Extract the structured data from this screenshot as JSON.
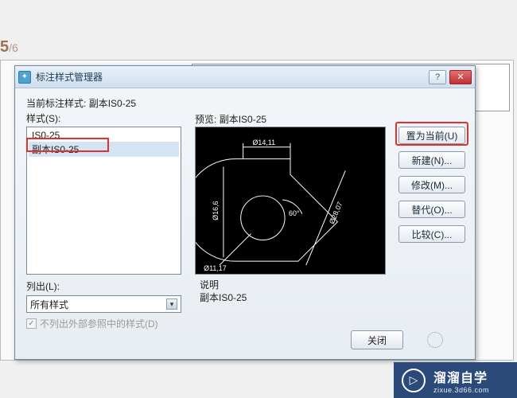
{
  "page": {
    "current": "5",
    "total": "/6"
  },
  "dialog": {
    "title": "标注样式管理器",
    "current_style_label": "当前标注样式:",
    "current_style_value": "副本IS0-25",
    "styles_label": "样式(S):",
    "styles": [
      {
        "name": "IS0-25"
      },
      {
        "name": "副本IS0-25"
      }
    ],
    "list_label": "列出(L):",
    "list_value": "所有样式",
    "checkbox_label": "不列出外部参照中的样式(D)",
    "preview_label_prefix": "预览:",
    "preview_label_value": "副本IS0-25",
    "desc_label": "说明",
    "desc_value": "副本IS0-25",
    "buttons": {
      "set_current": "置为当前(U)",
      "new": "新建(N)...",
      "modify": "修改(M)...",
      "override": "替代(O)...",
      "compare": "比较(C)..."
    },
    "close": "关闭",
    "help": "?",
    "x": "✕"
  },
  "preview_dims": {
    "d1": "Ø14,11",
    "d2": "Ø16,6",
    "d3": "Ø11,17",
    "d4": "Ø28,07",
    "a1": "60°"
  },
  "watermark": {
    "name": "溜溜自学",
    "url": "zixue.3d66.com"
  }
}
